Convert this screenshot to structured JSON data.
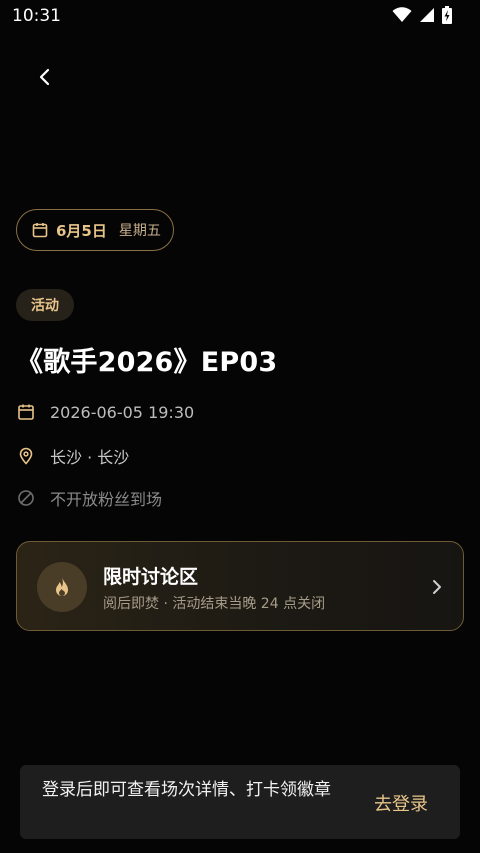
{
  "status_bar": {
    "time": "10:31",
    "icons": [
      "wifi-icon",
      "signal-icon",
      "battery-charging-icon"
    ]
  },
  "nav": {
    "back_icon": "chevron-left-icon"
  },
  "date_pill": {
    "date": "6月5日",
    "weekday": "星期五",
    "icon": "calendar-icon"
  },
  "event": {
    "tag": "活动",
    "title": "《歌手2026》EP03",
    "datetime": "2026-06-05 19:30",
    "location": "长沙 · 长沙",
    "fans_policy": "不开放粉丝到场"
  },
  "discussion": {
    "title": "限时讨论区",
    "subtitle": "阅后即焚 · 活动结束当晚 24 点关闭",
    "icon": "flame-icon"
  },
  "login_prompt": {
    "text": "登录后即可查看场次详情、打卡领徽章",
    "button": "去登录"
  },
  "colors": {
    "background": "#050505",
    "accent_gold": "#e8c48a",
    "card_border": "#6e5a36"
  }
}
